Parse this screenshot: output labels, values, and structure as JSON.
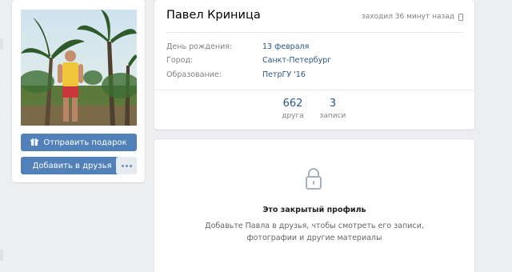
{
  "profile": {
    "name": "Павел Криница",
    "last_seen": "заходил 36 минут назад",
    "info": [
      {
        "label": "День рождения:",
        "value": "13 февраля"
      },
      {
        "label": "Город:",
        "value": "Санкт-Петербург"
      },
      {
        "label": "Образование:",
        "value": "ПетрГУ '16"
      }
    ],
    "counters": [
      {
        "count": "662",
        "label": "друга"
      },
      {
        "count": "3",
        "label": "записи"
      }
    ]
  },
  "actions": {
    "gift_label": "Отправить подарок",
    "add_friend_label": "Добавить в друзья"
  },
  "private": {
    "title": "Это закрытый профиль",
    "text": "Добавьте Павла в друзья, чтобы смотреть его записи, фотографии и другие материалы"
  },
  "colors": {
    "accent": "#5181b8",
    "link": "#2a5885",
    "background": "#edeef0"
  },
  "icons": [
    "gift-icon",
    "phone-icon",
    "lock-icon",
    "more-icon"
  ]
}
